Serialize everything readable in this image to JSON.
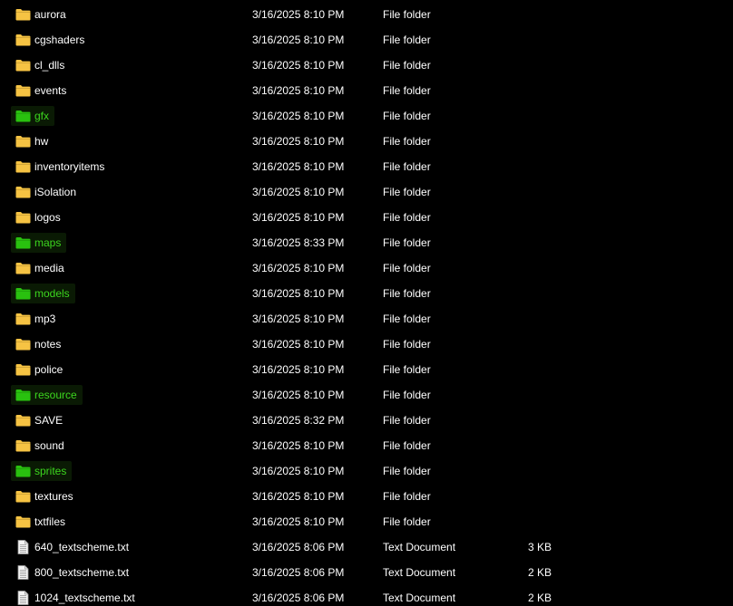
{
  "colors": {
    "background": "#000000",
    "text": "#ffffff",
    "folder": "#f6c343",
    "highlight_folder": "#29c10f",
    "highlight_text": "#3cd61e",
    "highlight_bg": "#0a1a04"
  },
  "files": [
    {
      "name": "aurora",
      "date": "3/16/2025 8:10 PM",
      "type": "File folder",
      "size": "",
      "icon": "folder-icon",
      "highlighted": false
    },
    {
      "name": "cgshaders",
      "date": "3/16/2025 8:10 PM",
      "type": "File folder",
      "size": "",
      "icon": "folder-icon",
      "highlighted": false
    },
    {
      "name": "cl_dlls",
      "date": "3/16/2025 8:10 PM",
      "type": "File folder",
      "size": "",
      "icon": "folder-icon",
      "highlighted": false
    },
    {
      "name": "events",
      "date": "3/16/2025 8:10 PM",
      "type": "File folder",
      "size": "",
      "icon": "folder-icon",
      "highlighted": false
    },
    {
      "name": "gfx",
      "date": "3/16/2025 8:10 PM",
      "type": "File folder",
      "size": "",
      "icon": "folder-icon",
      "highlighted": true
    },
    {
      "name": "hw",
      "date": "3/16/2025 8:10 PM",
      "type": "File folder",
      "size": "",
      "icon": "folder-icon",
      "highlighted": false
    },
    {
      "name": "inventoryitems",
      "date": "3/16/2025 8:10 PM",
      "type": "File folder",
      "size": "",
      "icon": "folder-icon",
      "highlighted": false
    },
    {
      "name": "iSolation",
      "date": "3/16/2025 8:10 PM",
      "type": "File folder",
      "size": "",
      "icon": "folder-icon",
      "highlighted": false
    },
    {
      "name": "logos",
      "date": "3/16/2025 8:10 PM",
      "type": "File folder",
      "size": "",
      "icon": "folder-icon",
      "highlighted": false
    },
    {
      "name": "maps",
      "date": "3/16/2025 8:33 PM",
      "type": "File folder",
      "size": "",
      "icon": "folder-icon",
      "highlighted": true
    },
    {
      "name": "media",
      "date": "3/16/2025 8:10 PM",
      "type": "File folder",
      "size": "",
      "icon": "folder-icon",
      "highlighted": false
    },
    {
      "name": "models",
      "date": "3/16/2025 8:10 PM",
      "type": "File folder",
      "size": "",
      "icon": "folder-icon",
      "highlighted": true
    },
    {
      "name": "mp3",
      "date": "3/16/2025 8:10 PM",
      "type": "File folder",
      "size": "",
      "icon": "folder-icon",
      "highlighted": false
    },
    {
      "name": "notes",
      "date": "3/16/2025 8:10 PM",
      "type": "File folder",
      "size": "",
      "icon": "folder-icon",
      "highlighted": false
    },
    {
      "name": "police",
      "date": "3/16/2025 8:10 PM",
      "type": "File folder",
      "size": "",
      "icon": "folder-icon",
      "highlighted": false
    },
    {
      "name": "resource",
      "date": "3/16/2025 8:10 PM",
      "type": "File folder",
      "size": "",
      "icon": "folder-icon",
      "highlighted": true
    },
    {
      "name": "SAVE",
      "date": "3/16/2025 8:32 PM",
      "type": "File folder",
      "size": "",
      "icon": "folder-icon",
      "highlighted": false
    },
    {
      "name": "sound",
      "date": "3/16/2025 8:10 PM",
      "type": "File folder",
      "size": "",
      "icon": "folder-icon",
      "highlighted": false
    },
    {
      "name": "sprites",
      "date": "3/16/2025 8:10 PM",
      "type": "File folder",
      "size": "",
      "icon": "folder-icon",
      "highlighted": true
    },
    {
      "name": "textures",
      "date": "3/16/2025 8:10 PM",
      "type": "File folder",
      "size": "",
      "icon": "folder-icon",
      "highlighted": false
    },
    {
      "name": "txtfiles",
      "date": "3/16/2025 8:10 PM",
      "type": "File folder",
      "size": "",
      "icon": "folder-icon",
      "highlighted": false
    },
    {
      "name": "640_textscheme.txt",
      "date": "3/16/2025 8:06 PM",
      "type": "Text Document",
      "size": "3 KB",
      "icon": "text-document-icon",
      "highlighted": false
    },
    {
      "name": "800_textscheme.txt",
      "date": "3/16/2025 8:06 PM",
      "type": "Text Document",
      "size": "2 KB",
      "icon": "text-document-icon",
      "highlighted": false
    },
    {
      "name": "1024_textscheme.txt",
      "date": "3/16/2025 8:06 PM",
      "type": "Text Document",
      "size": "2 KB",
      "icon": "text-document-icon",
      "highlighted": false
    }
  ]
}
